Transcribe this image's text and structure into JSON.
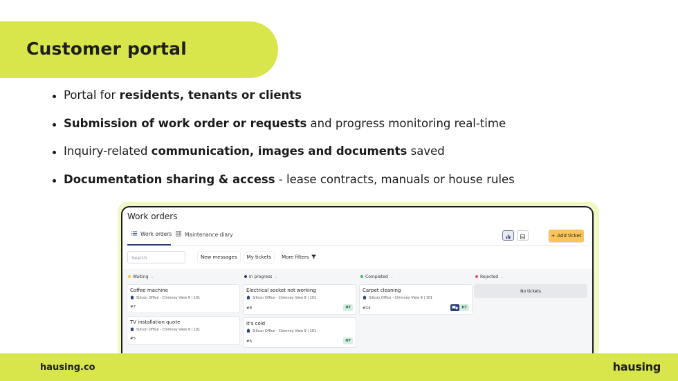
{
  "slide": {
    "title": "Customer portal",
    "bullets": [
      {
        "pre": "Portal for ",
        "bold": "residents, tenants or clients",
        "post": ""
      },
      {
        "pre": "",
        "bold": "Submission of work order or requests",
        "post": " and progress monitoring real-time"
      },
      {
        "pre": "Inquiry-related ",
        "bold": "communication, images and documents",
        "post": " saved"
      },
      {
        "pre": "",
        "bold": "Documentation sharing & access",
        "post": " - lease contracts, manuals or house rules"
      }
    ],
    "footer_site": "hausing.co",
    "footer_logo": "hausing"
  },
  "app": {
    "title": "Work orders",
    "tabs": [
      {
        "label": "Work orders",
        "icon": "list-icon",
        "active": true
      },
      {
        "label": "Maintenance diary",
        "icon": "grid-icon",
        "active": false
      }
    ],
    "add_button": "Add ticket",
    "search_placeholder": "Search",
    "filters": [
      "New messages",
      "My tickets"
    ],
    "more_filters": "More filters",
    "columns": [
      {
        "name": "Waiting",
        "color": "#f2c744",
        "cards": [
          {
            "title": "Coffee machine",
            "location": "Silicon Office - Chimney View 9 | 101",
            "number": "#7",
            "badge": ""
          },
          {
            "title": "TV installation quote",
            "location": "Silicon Office - Chimney View 9 | 101",
            "number": "#5",
            "badge": ""
          }
        ]
      },
      {
        "name": "In progress",
        "color": "#2a3f7a",
        "cards": [
          {
            "title": "Electrical socket not working",
            "location": "Silicon Office - Chimney View 9 | 101",
            "number": "#8",
            "badge": "HT"
          },
          {
            "title": "It's cold",
            "location": "Silicon Office - Chimney View 9 | 101",
            "number": "#6",
            "badge": "HT"
          }
        ]
      },
      {
        "name": "Completed",
        "color": "#3db36b",
        "cards": [
          {
            "title": "Carpet cleaning",
            "location": "Silicon Office - Chimney View 9 | 101",
            "number": "#14",
            "badge": "HT",
            "chat": true
          }
        ]
      },
      {
        "name": "Rejected",
        "color": "#e0506a",
        "empty": "No tickets"
      }
    ]
  },
  "colors": {
    "accent": "#d8e64b",
    "primary": "#2a3f7a",
    "add_button": "#f9c55a"
  }
}
